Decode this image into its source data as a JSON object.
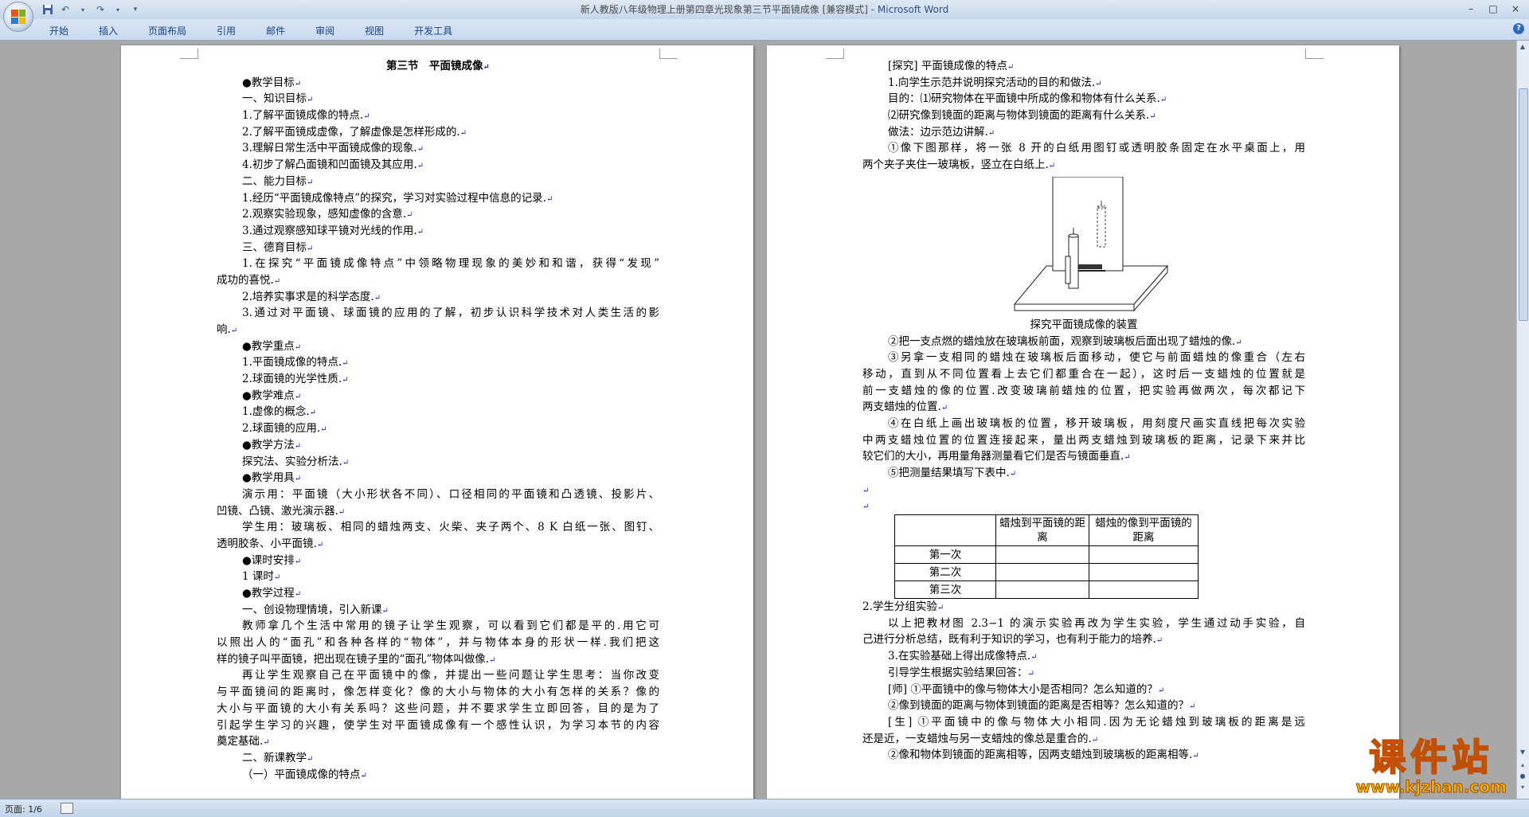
{
  "window": {
    "title": "新人教版八年级物理上册第四章光现象第三节平面镜成像 [兼容模式] - ",
    "app_name": "Microsoft Word",
    "controls": [
      "–",
      "□",
      "×"
    ]
  },
  "quick_access": [
    "save-icon",
    "undo-icon",
    "redo-icon",
    "customize-icon"
  ],
  "ribbon_tabs": [
    "开始",
    "插入",
    "页面布局",
    "引用",
    "邮件",
    "审阅",
    "视图",
    "开发工具"
  ],
  "status_bar": {
    "page_info": "页面: 1/6"
  },
  "watermark": {
    "title": "课件站",
    "url": "www.kjzhan.com"
  },
  "page1": {
    "lines": [
      {
        "t": "第三节　平面镜成像",
        "c": "center"
      },
      {
        "t": "●教学目标",
        "c": "ind"
      },
      {
        "t": "一、知识目标",
        "c": "ind"
      },
      {
        "t": "1.了解平面镜成像的特点.",
        "c": "ind"
      },
      {
        "t": "2.了解平面镜成虚像，了解虚像是怎样形成的.",
        "c": "ind"
      },
      {
        "t": "3.理解日常生活中平面镜成像的现象.",
        "c": "ind"
      },
      {
        "t": "4.初步了解凸面镜和凹面镜及其应用.",
        "c": "ind"
      },
      {
        "t": "二、能力目标",
        "c": "ind"
      },
      {
        "t": "1.经历“平面镜成像特点”的探究，学习对实验过程中信息的记录.",
        "c": "ind"
      },
      {
        "t": "2.观察实验现象，感知虚像的含意.",
        "c": "ind"
      },
      {
        "t": "3.通过观察感知球平镜对光线的作用.",
        "c": "ind"
      },
      {
        "t": "三、德育目标",
        "c": "ind"
      },
      {
        "t": "1.在探究“平面镜成像特点”中领略物理现象的美妙和和谐，获得“发现”",
        "c": "ind just"
      },
      {
        "t": "成功的喜悦.",
        "c": ""
      },
      {
        "t": "2.培养实事求是的科学态度.",
        "c": "ind"
      },
      {
        "t": "3.通过对平面镜、球面镜的应用的了解，初步认识科学技术对人类生活的影",
        "c": "ind just"
      },
      {
        "t": "响.",
        "c": ""
      },
      {
        "t": "●教学重点",
        "c": "ind"
      },
      {
        "t": "1.平面镜成像的特点.",
        "c": "ind"
      },
      {
        "t": "2.球面镜的光学性质.",
        "c": "ind"
      },
      {
        "t": "●教学难点",
        "c": "ind"
      },
      {
        "t": "1.虚像的概念.",
        "c": "ind"
      },
      {
        "t": "2.球面镜的应用.",
        "c": "ind"
      },
      {
        "t": "●教学方法",
        "c": "ind"
      },
      {
        "t": "探究法、实验分析法.",
        "c": "ind"
      },
      {
        "t": "●教学用具",
        "c": "ind"
      },
      {
        "t": "演示用：平面镜（大小形状各不同）、口径相同的平面镜和凸透镜、投影片、",
        "c": "ind just"
      },
      {
        "t": "凹镜、凸镜、激光演示器.",
        "c": ""
      },
      {
        "t": "学生用：玻璃板、相同的蜡烛两支、火柴、夹子两个、8 K 白纸一张、图钉、",
        "c": "ind just"
      },
      {
        "t": "透明胶条、小平面镜.",
        "c": ""
      },
      {
        "t": "●课时安排",
        "c": "ind"
      },
      {
        "t": "1 课时",
        "c": "ind"
      },
      {
        "t": "●教学过程",
        "c": "ind"
      },
      {
        "t": "一、创设物理情境，引入新课",
        "c": "ind"
      },
      {
        "t": "教师拿几个生活中常用的镜子让学生观察，可以看到它们都是平的.用它可",
        "c": "ind just"
      },
      {
        "t": "以照出人的“面孔”和各种各样的“物体”，并与物体本身的形状一样.我们把这",
        "c": "just"
      },
      {
        "t": "样的镜子叫平面镜，把出现在镜子里的“面孔”物体叫做像.",
        "c": ""
      },
      {
        "t": "再让学生观察自己在平面镜中的像，并提出一些问题让学生思考：当你改变",
        "c": "ind just"
      },
      {
        "t": "与平面镜间的距离时，像怎样变化？像的大小与物体的大小有怎样的关系？像的",
        "c": "just"
      },
      {
        "t": "大小与平面镜的大小有关系吗？这些问题，并不要求学生立即回答，目的是为了",
        "c": "just"
      },
      {
        "t": "引起学生学习的兴趣，使学生对平面镜成像有一个感性认识，为学习本节的内容",
        "c": "just"
      },
      {
        "t": "奠定基础.",
        "c": ""
      },
      {
        "t": "二、新课教学",
        "c": "ind"
      },
      {
        "t": "（一）平面镜成像的特点",
        "c": "ind"
      }
    ]
  },
  "page2": {
    "lines_top": [
      {
        "t": "[探究] 平面镜成像的特点",
        "c": "ind"
      },
      {
        "t": "1.向学生示范并说明探究活动的目的和做法.",
        "c": "ind"
      },
      {
        "t": "目的：⑴研究物体在平面镜中所成的像和物体有什么关系.",
        "c": "ind"
      },
      {
        "t": "⑵研究像到镜面的距离与物体到镜面的距离有什么关系.",
        "c": "ind"
      },
      {
        "t": "做法：边示范边讲解.",
        "c": "ind"
      },
      {
        "t": "①像下图那样，将一张 8 开的白纸用图钉或透明胶条固定在水平桌面上，用",
        "c": "ind just"
      },
      {
        "t": "两个夹子夹住一玻璃板，竖立在白纸上.",
        "c": ""
      }
    ],
    "figure_caption": "探究平面镜成像的装置",
    "lines_mid": [
      {
        "t": "②把一支点燃的蜡烛放在玻璃板前面，观察到玻璃板后面出现了蜡烛的像.",
        "c": "ind"
      },
      {
        "t": "③另拿一支相同的蜡烛在玻璃板后面移动，使它与前面蜡烛的像重合（左右",
        "c": "ind just"
      },
      {
        "t": "移动，直到从不同位置看上去它们都重合在一起），这时后一支蜡烛的位置就是",
        "c": "just"
      },
      {
        "t": "前一支蜡烛的像的位置.改变玻璃前蜡烛的位置，把实验再做两次，每次都记下",
        "c": "just"
      },
      {
        "t": "两支蜡烛的位置.",
        "c": ""
      },
      {
        "t": "④在白纸上画出玻璃板的位置，移开玻璃板，用刻度尺画实直线把每次实验",
        "c": "ind just"
      },
      {
        "t": "中两支蜡烛位置的位置连接起来，量出两支蜡烛到玻璃板的距离，记录下来并比",
        "c": "just"
      },
      {
        "t": "较它们的大小，再用量角器测量看它们是否与镜面垂直.",
        "c": ""
      },
      {
        "t": "⑤把测量结果填写下表中.",
        "c": "ind"
      }
    ],
    "table": {
      "headers": [
        "",
        "蜡烛到平面镜的距离",
        "蜡烛的像到平面镜的距离"
      ],
      "rows": [
        [
          "第一次",
          "",
          ""
        ],
        [
          "第二次",
          "",
          ""
        ],
        [
          "第三次",
          "",
          ""
        ]
      ]
    },
    "lines_bottom": [
      {
        "t": "2.学生分组实验",
        "c": ""
      },
      {
        "t": "以上把教材图 2.3−1 的演示实验再改为学生实验，学生通过动手实验，自",
        "c": "ind just"
      },
      {
        "t": "己进行分析总结，既有利于知识的学习，也有利于能力的培养.",
        "c": ""
      },
      {
        "t": "3.在实验基础上得出成像特点.",
        "c": "ind"
      },
      {
        "t": "引导学生根据实验结果回答：",
        "c": "ind"
      },
      {
        "t": "[师] ①平面镜中的像与物体大小是否相同？怎么知道的？",
        "c": "ind"
      },
      {
        "t": "②像到镜面的距离与物体到镜面的距离是否相等？怎么知道的？",
        "c": "ind"
      },
      {
        "t": "[生] ①平面镜中的像与物体大小相同.因为无论蜡烛到玻璃板的距离是远",
        "c": "ind just"
      },
      {
        "t": "还是近，一支蜡烛与另一支蜡烛的像总是重合的.",
        "c": ""
      },
      {
        "t": "②像和物体到镜面的距离相等，因两支蜡烛到玻璃板的距离相等.",
        "c": "ind"
      }
    ]
  }
}
